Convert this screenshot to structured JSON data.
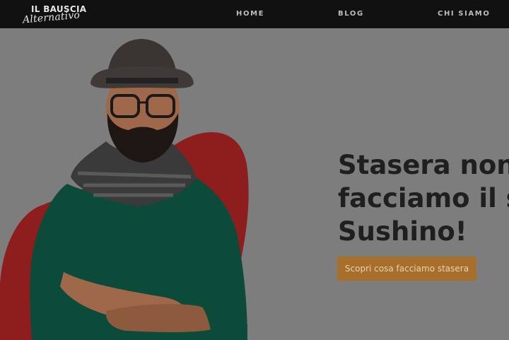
{
  "header": {
    "logo_line1": "IL BAUSCIA",
    "logo_line2": "Alternativo",
    "nav": [
      "HOME",
      "BLOG",
      "CHI SIAMO"
    ]
  },
  "hero": {
    "headline_lines": [
      "Stasera non",
      "facciamo il s",
      "Sushino!"
    ],
    "cta_label": "Scopri cosa facciamo stasera"
  },
  "colors": {
    "page_background": "#7d7d7d",
    "topbar": "#111111",
    "accent_blob": "#8e1e1e",
    "cta": "#a86e2b",
    "sweater": "#0c4a3a"
  },
  "icons": {
    "portrait": "man-with-hat-and-glasses-photo"
  }
}
